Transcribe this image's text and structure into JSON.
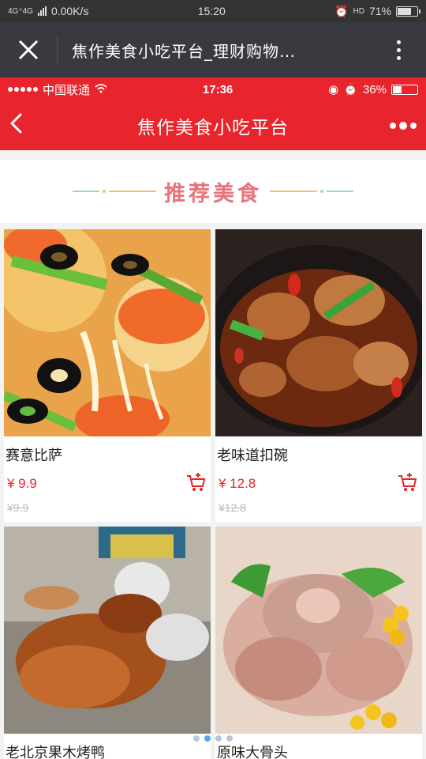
{
  "outer_status": {
    "network": "4G⁺4G",
    "speed": "0.00K/s",
    "time": "15:20",
    "hd": "HD",
    "battery": "71%",
    "battery_level": 0.71
  },
  "wechat": {
    "title": "焦作美食小吃平台_理财购物…"
  },
  "inner_status": {
    "carrier": "中国联通",
    "time": "17:36",
    "battery": "36%",
    "battery_level": 0.36
  },
  "nav": {
    "back": "‹",
    "title": "焦作美食小吃平台"
  },
  "section": {
    "title": "推荐美食"
  },
  "colors": {
    "brand_red": "#e8242c",
    "accent_pink": "#e8737a",
    "deco_green": "#8fd3a5",
    "deco_orange": "#f2c06a"
  },
  "products": [
    {
      "name": "赛意比萨",
      "price": "¥ 9.9",
      "old_price": "¥9.9"
    },
    {
      "name": "老味道扣碗",
      "price": "¥ 12.8",
      "old_price": "¥12.8"
    },
    {
      "name": "老北京果木烤鸭",
      "price": "",
      "old_price": ""
    },
    {
      "name": "原味大骨头",
      "price": "",
      "old_price": ""
    }
  ],
  "carousel": {
    "pages": 4,
    "active": 2
  },
  "icons": {
    "close": "close-icon",
    "more": "more-vertical-icon",
    "back": "back-arrow-icon",
    "nav_more": "more-horizontal-icon",
    "cart": "cart-add-icon"
  }
}
